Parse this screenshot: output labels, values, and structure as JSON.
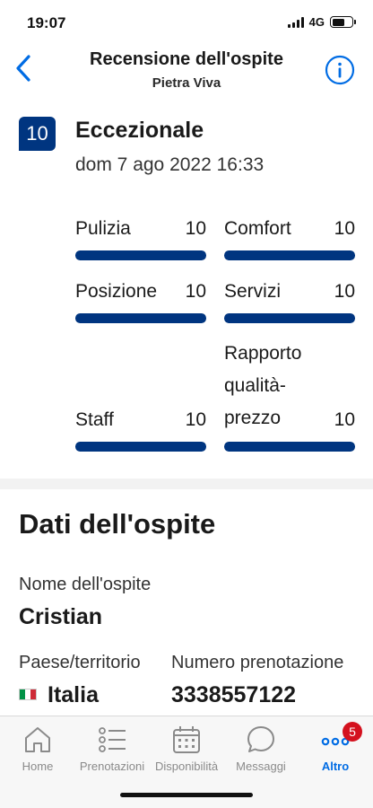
{
  "status": {
    "time": "19:07",
    "network": "4G"
  },
  "header": {
    "title": "Recensione dell'ospite",
    "subtitle": "Pietra Viva"
  },
  "review": {
    "score": "10",
    "verdict": "Eccezionale",
    "date": "dom 7 ago 2022 16:33",
    "categories": [
      {
        "label": "Pulizia",
        "value": "10",
        "fraction": 1.0
      },
      {
        "label": "Comfort",
        "value": "10",
        "fraction": 1.0
      },
      {
        "label": "Posizione",
        "value": "10",
        "fraction": 1.0
      },
      {
        "label": "Servizi",
        "value": "10",
        "fraction": 1.0
      },
      {
        "label": "Staff",
        "value": "10",
        "fraction": 1.0
      },
      {
        "label": "Rapporto qualità-prezzo",
        "label_lines": [
          "Rapporto",
          "qualità-",
          "prezzo"
        ],
        "value": "10",
        "fraction": 1.0
      }
    ]
  },
  "guest": {
    "section_title": "Dati dell'ospite",
    "name_label": "Nome dell'ospite",
    "name_value": "Cristian",
    "country_label": "Paese/territorio",
    "country_value": "Italia",
    "booking_label": "Numero prenotazione",
    "booking_value": "3338557122"
  },
  "tabs": [
    {
      "label": "Home",
      "icon": "home-icon"
    },
    {
      "label": "Prenotazioni",
      "icon": "list-icon"
    },
    {
      "label": "Disponibilità",
      "icon": "calendar-icon"
    },
    {
      "label": "Messaggi",
      "icon": "chat-bubble-icon"
    },
    {
      "label": "Altro",
      "icon": "more-icon",
      "badge": "5",
      "active": true
    }
  ],
  "colors": {
    "brand": "#003580",
    "accent": "#006ce4",
    "badge": "#d4111e"
  }
}
